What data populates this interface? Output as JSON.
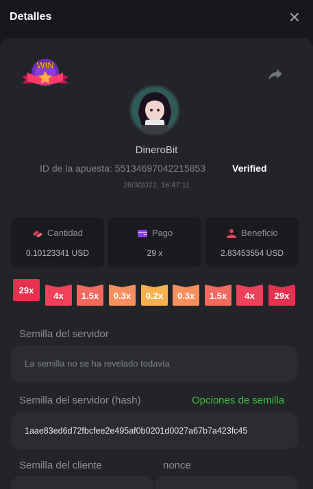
{
  "header": {
    "title": "Detalles",
    "close_icon": "close-icon"
  },
  "bet": {
    "username": "DineroBit",
    "bet_id": "ID de la apuesta: 55134697042215853",
    "verified": "Verified",
    "datetime": "28/3/2022, 16:47:11"
  },
  "stats": [
    {
      "label": "Cantidad",
      "value": "0.10123341 USD",
      "icon": "coins-icon",
      "color": "#e0405a"
    },
    {
      "label": "Pago",
      "value": "29 x",
      "icon": "wallet-icon",
      "color": "#8b3cf0"
    },
    {
      "label": "Beneficio",
      "value": "2.83453554 USD",
      "icon": "profit-icon",
      "color": "#e0405a"
    }
  ],
  "multipliers": {
    "selected": "29x",
    "list": [
      "4x",
      "1.5x",
      "0.3x",
      "0.2x",
      "0.3x",
      "1.5x",
      "4x",
      "29x"
    ]
  },
  "seeds": {
    "server_seed_label": "Semilla del servidor",
    "server_seed_value": "La semilla no se ha revelado todavía",
    "server_hash_label": "Semilla del servidor (hash)",
    "seed_options_link": "Opciones de semilla",
    "server_hash_value": "1aae83ed6d72fbcfee2e495af0b0201d0027a67b7a423fc45",
    "client_seed_label": "Semilla del cliente",
    "nonce_label": "nonce"
  },
  "colors": {
    "accent_green": "#3fbf3f",
    "verified": "#ffffff"
  }
}
